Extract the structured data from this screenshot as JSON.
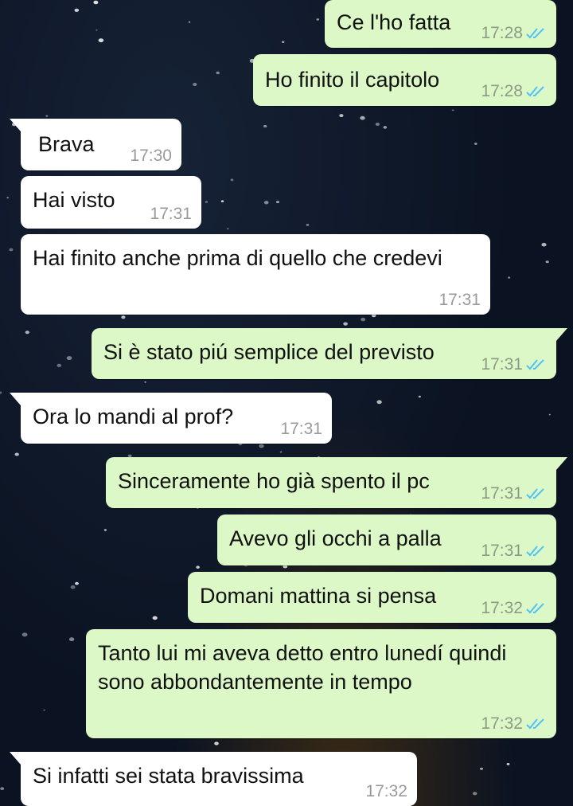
{
  "colors": {
    "outgoing_bubble": "#dcf8c6",
    "incoming_bubble": "#ffffff",
    "read_tick": "#4fc3f7",
    "background": "#0b1322"
  },
  "messages": [
    {
      "id": "m1",
      "direction": "out",
      "text": "Ce l'ho fatta",
      "time": "17:28",
      "status_icon": "double-check-read-icon"
    },
    {
      "id": "m2",
      "direction": "out",
      "text": "Ho finito il capitolo",
      "time": "17:28",
      "status_icon": "double-check-read-icon"
    },
    {
      "id": "m3",
      "direction": "in",
      "text": "Brava",
      "time": "17:30"
    },
    {
      "id": "m4",
      "direction": "in",
      "text": "Hai visto",
      "time": "17:31"
    },
    {
      "id": "m5",
      "direction": "in",
      "text": "Hai finito anche prima di quello che credevi",
      "time": "17:31"
    },
    {
      "id": "m6",
      "direction": "out",
      "text": "Si è stato piú semplice del previsto",
      "time": "17:31",
      "status_icon": "double-check-read-icon"
    },
    {
      "id": "m7",
      "direction": "in",
      "text": "Ora lo mandi al prof?",
      "time": "17:31"
    },
    {
      "id": "m8",
      "direction": "out",
      "text": "Sinceramente ho già spento il pc",
      "time": "17:31",
      "status_icon": "double-check-read-icon"
    },
    {
      "id": "m9",
      "direction": "out",
      "text": "Avevo gli occhi a palla",
      "time": "17:31",
      "status_icon": "double-check-read-icon"
    },
    {
      "id": "m10",
      "direction": "out",
      "text": "Domani mattina si pensa",
      "time": "17:32",
      "status_icon": "double-check-read-icon"
    },
    {
      "id": "m11",
      "direction": "out",
      "text": "Tanto lui mi aveva detto entro lunedí quindi sono abbondantemente in tempo",
      "time": "17:32",
      "status_icon": "double-check-read-icon"
    },
    {
      "id": "m12",
      "direction": "in",
      "text": "Si infatti sei stata bravissima",
      "time": "17:32"
    }
  ]
}
